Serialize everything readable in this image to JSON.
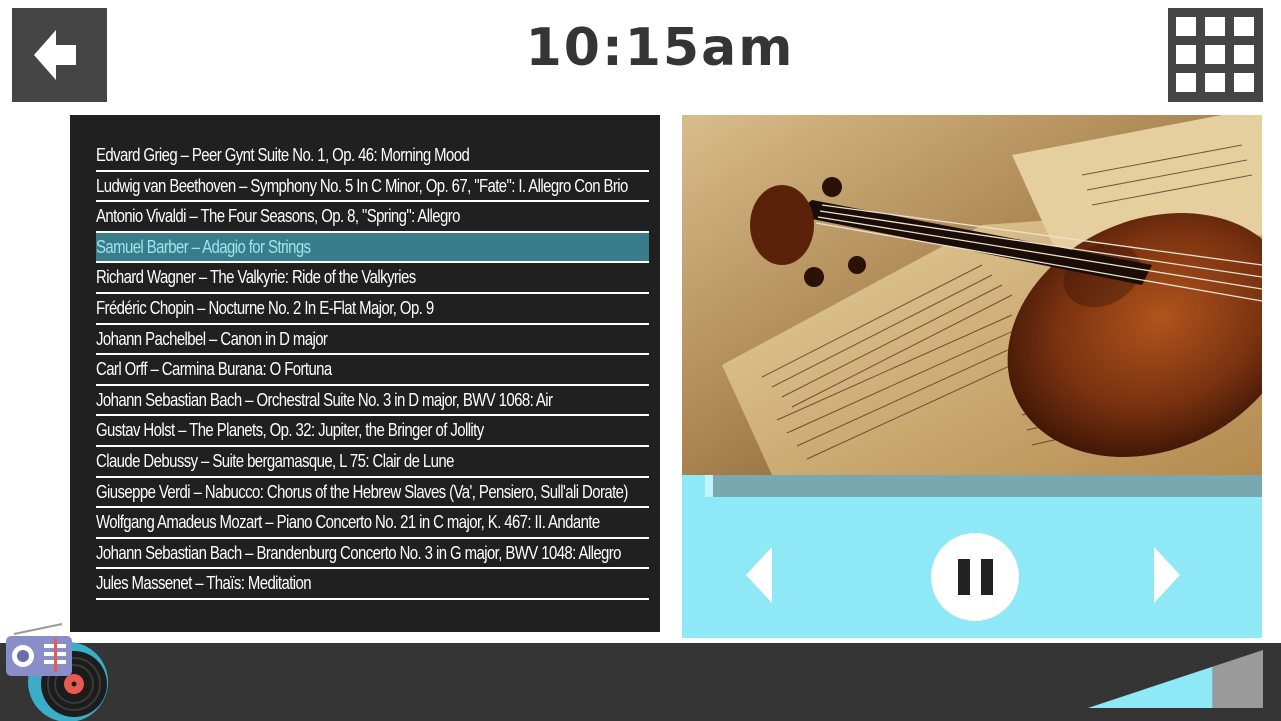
{
  "header": {
    "back_icon": "back-arrow-icon",
    "time": "10:15am",
    "apps_icon": "grid-menu-icon"
  },
  "playlist": {
    "active_index": 3,
    "tracks": [
      "Edvard Grieg – Peer Gynt Suite No. 1, Op. 46: Morning Mood",
      "Ludwig van Beethoven – Symphony No. 5 In C Minor, Op. 67, \"Fate\": I. Allegro Con Brio",
      "Antonio Vivaldi – The Four Seasons, Op. 8, \"Spring\": Allegro",
      "Samuel Barber – Adagio for Strings",
      "Richard Wagner – The Valkyrie: Ride of the Valkyries",
      "Frédéric Chopin – Nocturne No. 2 In E-Flat Major, Op. 9",
      "Johann Pachelbel – Canon in D major",
      "Carl Orff – Carmina Burana: O Fortuna",
      "Johann Sebastian Bach – Orchestral Suite No. 3 in D major, BWV 1068: Air",
      "Gustav Holst – The Planets, Op. 32: Jupiter, the Bringer of Jollity",
      "Claude Debussy – Suite bergamasque, L 75: Clair de Lune",
      "Giuseppe Verdi – Nabucco: Chorus of the Hebrew Slaves (Va', Pensiero, Sull'ali Dorate)",
      "Wolfgang Amadeus Mozart – Piano Concerto No. 21 in C major, K. 467: II. Andante",
      "Johann Sebastian Bach – Brandenburg Concerto No. 3 in G major, BWV 1048: Allegro",
      "Jules Massenet – Thaïs: Meditation"
    ]
  },
  "player": {
    "artwork": "violin-and-sheet-music-image",
    "progress_fraction": 0.05,
    "prev_icon": "previous-icon",
    "pause_icon": "pause-icon",
    "next_icon": "next-icon"
  },
  "footer": {
    "logo": "radio-vinyl-logo",
    "volume_fraction": 0.71,
    "volume_icon": "volume-level-icon"
  },
  "colors": {
    "tile_dark": "#454545",
    "playlist_bg": "#202020",
    "active_row": "#3a7d8a",
    "control_bg": "#8fe8f5",
    "progress_track": "#7aa8b0",
    "bottom_bar": "#353535"
  }
}
